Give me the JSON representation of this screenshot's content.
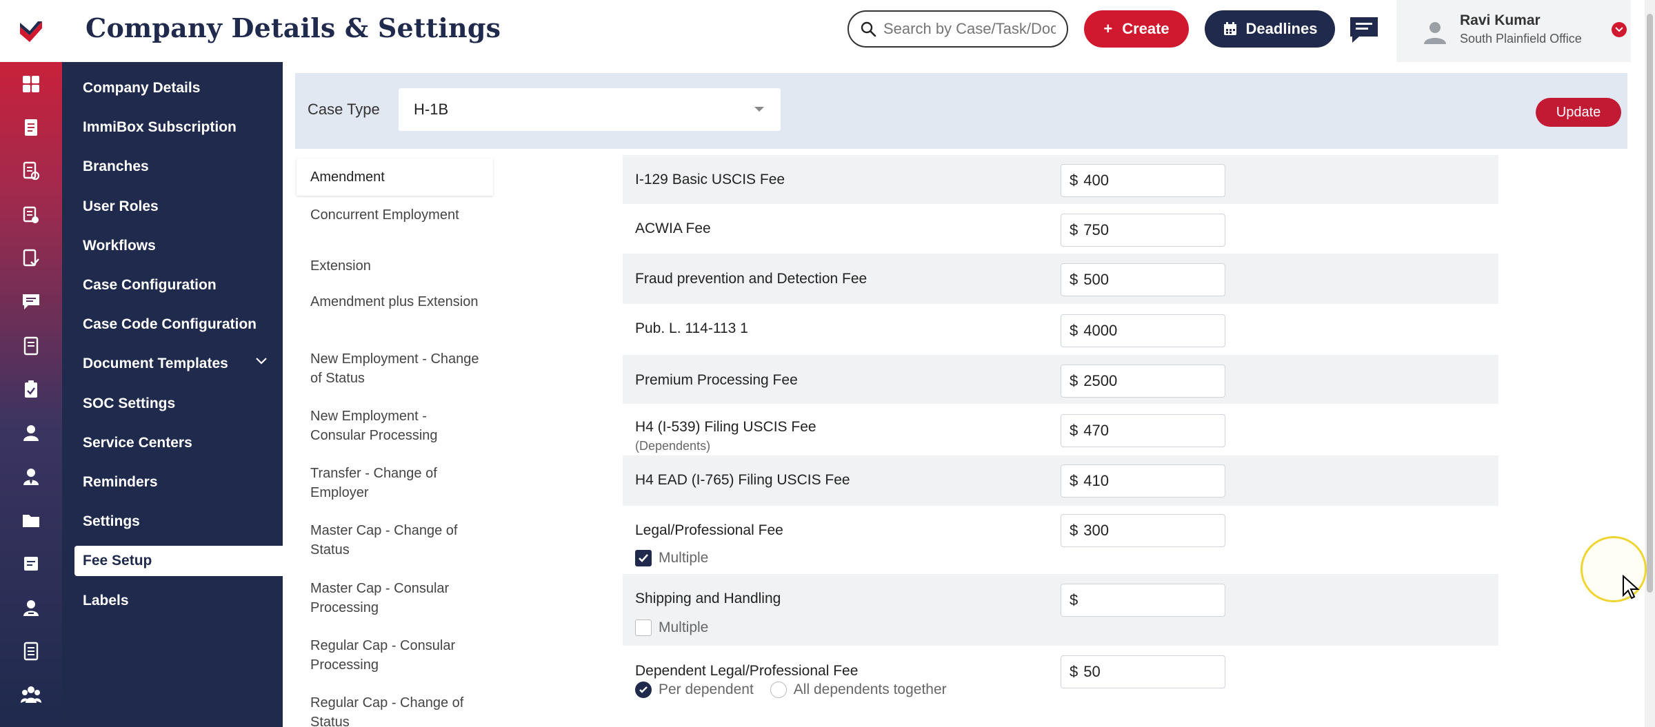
{
  "header": {
    "title": "Company Details & Settings",
    "search_placeholder": "Search by Case/Task/Document",
    "create_label": "Create",
    "deadlines_label": "Deadlines",
    "user_name": "Ravi Kumar",
    "user_office": "South Plainfield Office"
  },
  "rail": {
    "icons": [
      "dashboard-icon",
      "document-icon",
      "form-icon",
      "checklist-icon",
      "file-check-icon",
      "chat-icon",
      "notebook-icon",
      "clipboard-icon",
      "person-icon",
      "user-tie-icon",
      "folder-icon",
      "note-icon",
      "user-badge-icon",
      "book-icon",
      "team-icon"
    ]
  },
  "menu": {
    "items": [
      {
        "label": "Company Details"
      },
      {
        "label": "ImmiBox Subscription"
      },
      {
        "label": "Branches"
      },
      {
        "label": "User Roles"
      },
      {
        "label": "Workflows"
      },
      {
        "label": "Case Configuration"
      },
      {
        "label": "Case Code Configuration"
      },
      {
        "label": "Document Templates"
      },
      {
        "label": "SOC Settings"
      },
      {
        "label": "Service Centers"
      },
      {
        "label": "Reminders"
      },
      {
        "label": "Settings"
      },
      {
        "label": "Fee Setup"
      },
      {
        "label": "Labels"
      }
    ],
    "active": "Fee Setup"
  },
  "case": {
    "label": "Case Type",
    "value": "H-1B",
    "update_label": "Update"
  },
  "subtypes": [
    "Amendment",
    "Concurrent Employment",
    "Extension",
    "Amendment plus Extension",
    "New Employment - Change of Status",
    "New Employment - Consular Processing",
    "Transfer - Change of Employer",
    "Master Cap - Change of Status",
    "Master Cap - Consular Processing",
    "Regular Cap - Consular Processing",
    "Regular Cap - Change of Status"
  ],
  "fees": [
    {
      "label": "I-129 Basic USCIS Fee",
      "currency": "$",
      "value": "400"
    },
    {
      "label": "ACWIA Fee",
      "currency": "$",
      "value": "750"
    },
    {
      "label": "Fraud prevention and Detection Fee",
      "currency": "$",
      "value": "500"
    },
    {
      "label": "Pub. L. 114-113 1",
      "currency": "$",
      "value": "4000"
    },
    {
      "label": "Premium Processing Fee",
      "currency": "$",
      "value": "2500"
    },
    {
      "label": "H4 (I-539) Filing USCIS Fee",
      "sublabel": "(Dependents)",
      "currency": "$",
      "value": "470"
    },
    {
      "label": "H4 EAD (I-765) Filing USCIS Fee",
      "currency": "$",
      "value": "410"
    },
    {
      "label": "Legal/Professional Fee",
      "currency": "$",
      "value": "300",
      "multiple_label": "Multiple",
      "multiple_checked": true
    },
    {
      "label": "Shipping and Handling",
      "currency": "$",
      "value": "",
      "multiple_label": "Multiple",
      "multiple_checked": false
    },
    {
      "label": "Dependent Legal/Professional Fee",
      "currency": "$",
      "value": "50",
      "option_a": "Per dependent",
      "option_b": "All dependents together"
    }
  ],
  "colors": {
    "brand_navy": "#1f2a4d",
    "brand_red": "#d0192e",
    "casebar_bg": "#e1e8f2",
    "row_shade": "#f1f2f3"
  }
}
